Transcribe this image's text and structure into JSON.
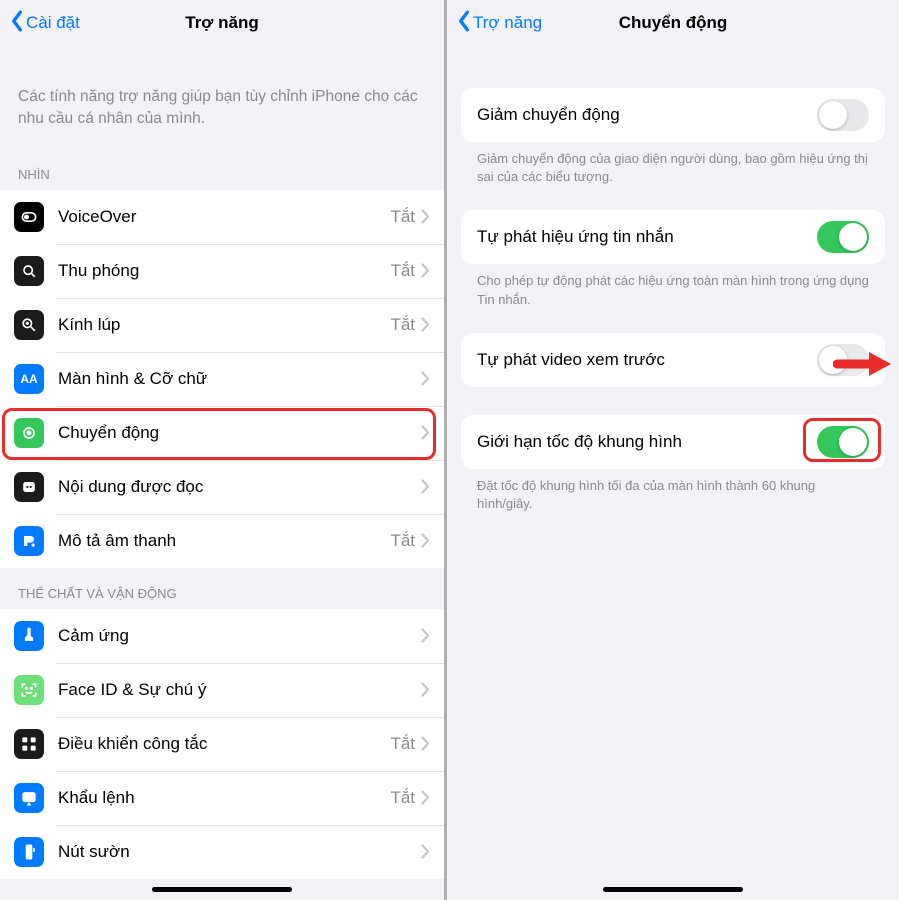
{
  "left": {
    "back": "Cài đặt",
    "title": "Trợ năng",
    "intro": "Các tính năng trợ năng giúp bạn tùy chỉnh iPhone cho các nhu cầu cá nhân của mình.",
    "sections": {
      "vision_header": "NHÌN",
      "vision": [
        {
          "label": "VoiceOver",
          "value": "Tắt"
        },
        {
          "label": "Thu phóng",
          "value": "Tắt"
        },
        {
          "label": "Kính lúp",
          "value": "Tắt"
        },
        {
          "label": "Màn hình & Cỡ chữ",
          "value": ""
        },
        {
          "label": "Chuyển động",
          "value": ""
        },
        {
          "label": "Nội dung được đọc",
          "value": ""
        },
        {
          "label": "Mô tả âm thanh",
          "value": "Tắt"
        }
      ],
      "motor_header": "THỂ CHẤT VÀ VẬN ĐỘNG",
      "motor": [
        {
          "label": "Cảm ứng",
          "value": ""
        },
        {
          "label": "Face ID & Sự chú ý",
          "value": ""
        },
        {
          "label": "Điều khiển công tắc",
          "value": "Tắt"
        },
        {
          "label": "Khẩu lệnh",
          "value": "Tắt"
        },
        {
          "label": "Nút sườn",
          "value": ""
        }
      ]
    }
  },
  "right": {
    "back": "Trợ năng",
    "title": "Chuyển động",
    "groups": [
      {
        "rows": [
          {
            "label": "Giảm chuyển động",
            "toggle": "off"
          }
        ],
        "footer": "Giảm chuyển động của giao diện người dùng, bao gồm hiệu ứng thị sai của các biểu tượng."
      },
      {
        "rows": [
          {
            "label": "Tự phát hiệu ứng tin nhắn",
            "toggle": "on"
          }
        ],
        "footer": "Cho phép tự động phát các hiệu ứng toàn màn hình trong ứng dụng Tin nhắn."
      },
      {
        "rows": [
          {
            "label": "Tự phát video xem trước",
            "toggle": "off"
          }
        ],
        "footer": ""
      },
      {
        "rows": [
          {
            "label": "Giới hạn tốc độ khung hình",
            "toggle": "on"
          }
        ],
        "footer": "Đặt tốc độ khung hình tối đa của màn hình thành 60 khung hình/giây."
      }
    ]
  }
}
